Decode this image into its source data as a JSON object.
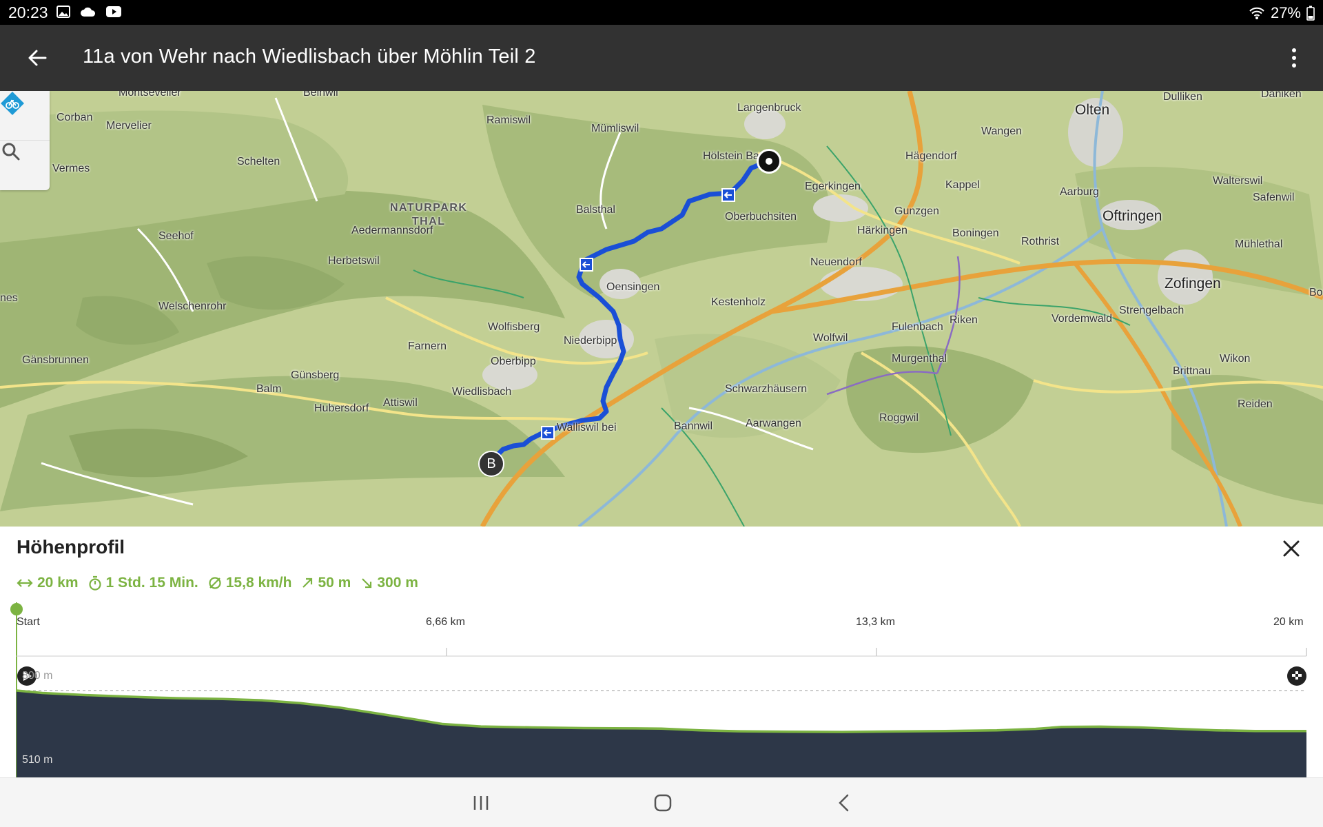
{
  "status_bar": {
    "time": "20:23",
    "battery": "27%",
    "left_icons": [
      "image-icon",
      "cloud-icon",
      "youtube-icon"
    ],
    "right_icons": [
      "wifi-icon",
      "battery-icon"
    ]
  },
  "app_bar": {
    "title": "11a von Wehr nach Wiedlisbach über Möhlin Teil 2",
    "back_icon": "arrow-left-icon",
    "menu_icon": "more-vert-icon"
  },
  "map": {
    "tools": [
      "bike-layer-icon",
      "search-icon"
    ],
    "route_color": "#1a4fd6",
    "marker_b_label": "B",
    "place_labels": [
      "Montsevelier",
      "Beinwil",
      "Corban",
      "Mervelier",
      "Ramiswil",
      "Mümliswil",
      "Langenbruck",
      "Olten",
      "Dulliken",
      "Däniken",
      "Wangen",
      "Vermes",
      "Schelten",
      "Hölstein Bank",
      "Hägendorf",
      "Egerkingen",
      "Kappel",
      "Aarburg",
      "Walterswil",
      "Safenwil",
      "Gunzgen",
      "Oftringen",
      "Balsthal",
      "Oberbuchsiten",
      "Härkingen",
      "Boningen",
      "Seehof",
      "Aedermannsdorf",
      "Rothrist",
      "Mühlethal",
      "Herbetswil",
      "Neuendorf",
      "Zofingen",
      "Oensingen",
      "nes",
      "Kestenholz",
      "Bo",
      "Welschenrohr",
      "Strengelbach",
      "Riken",
      "Vordemwald",
      "Fulenbach",
      "Wolfisberg",
      "Wolfwil",
      "Niederbipp",
      "Farnern",
      "Wikon",
      "Gänsbrunnen",
      "Murgenthal",
      "Oberbipp",
      "Brittnau",
      "Günsberg",
      "Balm",
      "Wiedlisbach",
      "Schwarzhäusern",
      "Attiswil",
      "Reiden",
      "Hubersdorf",
      "Roggwil",
      "Walliswil bei",
      "Bannwil",
      "Aarwangen"
    ],
    "park_label": "NATURPARK\nTHAL"
  },
  "panel": {
    "title": "Höhenprofil",
    "close_icon": "close-icon",
    "stats": {
      "distance": "20 km",
      "duration": "1 Std. 15 Min.",
      "avg_speed": "15,8 km/h",
      "ascent": "50 m",
      "descent": "300 m"
    },
    "stat_icons": [
      "distance-arrows-icon",
      "stopwatch-icon",
      "average-icon",
      "ascent-arrow-icon",
      "descent-arrow-icon"
    ],
    "accent_color": "#7cb342",
    "profile_fill": "#2d3748",
    "axis": {
      "start": "Start",
      "mark1": "6,66 km",
      "mark2": "13,3 km",
      "end": "20 km"
    },
    "y_labels": {
      "top": "800 m",
      "bottom": "510 m"
    },
    "profile_points": [
      [
        0,
        800
      ],
      [
        0.02,
        790
      ],
      [
        0.05,
        782
      ],
      [
        0.08,
        776
      ],
      [
        0.1,
        772
      ],
      [
        0.13,
        768
      ],
      [
        0.16,
        765
      ],
      [
        0.19,
        760
      ],
      [
        0.22,
        748
      ],
      [
        0.25,
        730
      ],
      [
        0.28,
        705
      ],
      [
        0.31,
        680
      ],
      [
        0.33,
        662
      ],
      [
        0.36,
        652
      ],
      [
        0.4,
        648
      ],
      [
        0.44,
        645
      ],
      [
        0.48,
        644
      ],
      [
        0.5,
        643
      ],
      [
        0.53,
        636
      ],
      [
        0.56,
        632
      ],
      [
        0.6,
        630
      ],
      [
        0.64,
        629
      ],
      [
        0.68,
        631
      ],
      [
        0.72,
        633
      ],
      [
        0.76,
        636
      ],
      [
        0.79,
        642
      ],
      [
        0.81,
        650
      ],
      [
        0.84,
        651
      ],
      [
        0.87,
        648
      ],
      [
        0.9,
        642
      ],
      [
        0.93,
        636
      ],
      [
        0.96,
        633
      ],
      [
        1.0,
        633
      ]
    ]
  },
  "nav_bar": {
    "buttons": [
      "recents-icon",
      "home-icon",
      "back-icon"
    ]
  }
}
